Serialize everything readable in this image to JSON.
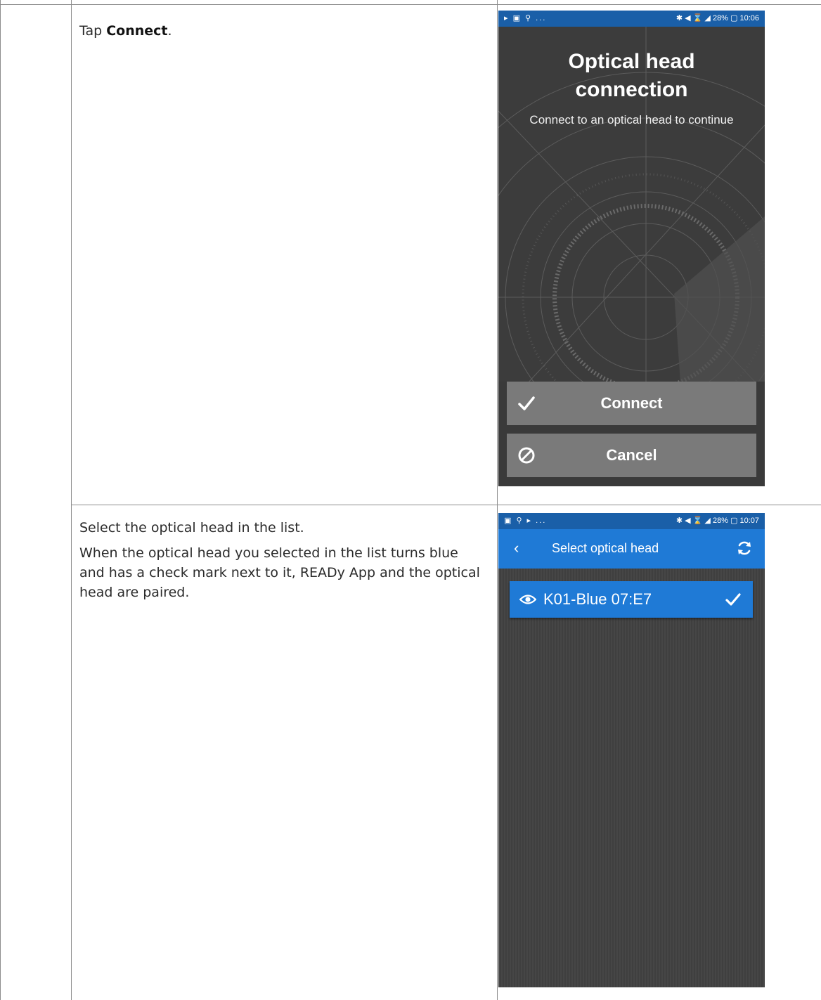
{
  "steps": [
    {
      "prefix": "Tap ",
      "bold": "Connect",
      "suffix": "."
    },
    {
      "paragraphs": [
        "Select the optical head in the list.",
        "When the optical head you selected in the list turns blue and has a check mark next to it, READy App and the optical head are paired."
      ]
    }
  ],
  "screen1": {
    "status_left": "▸ ▣ ⚲ ...",
    "status_right": "✱ ◀ ⌛ ◢ 28% ▢ 10:06",
    "title_line1": "Optical head",
    "title_line2": "connection",
    "subtitle": "Connect to an optical head to continue",
    "connect_label": "Connect",
    "cancel_label": "Cancel",
    "colors": {
      "status": "#1a5fa8",
      "button": "#7a7a7a",
      "background": "#3b3b3b"
    }
  },
  "screen2": {
    "status_left": "▣ ⚲ ▸ ...",
    "status_right": "✱ ◀ ⌛ ◢ 28% ▢ 10:07",
    "back_glyph": "‹",
    "title": "Select optical head",
    "item_name": "K01-Blue 07:E7",
    "colors": {
      "appbar": "#1f7ad6",
      "selected": "#1f7ad6",
      "background": "#454545"
    }
  }
}
